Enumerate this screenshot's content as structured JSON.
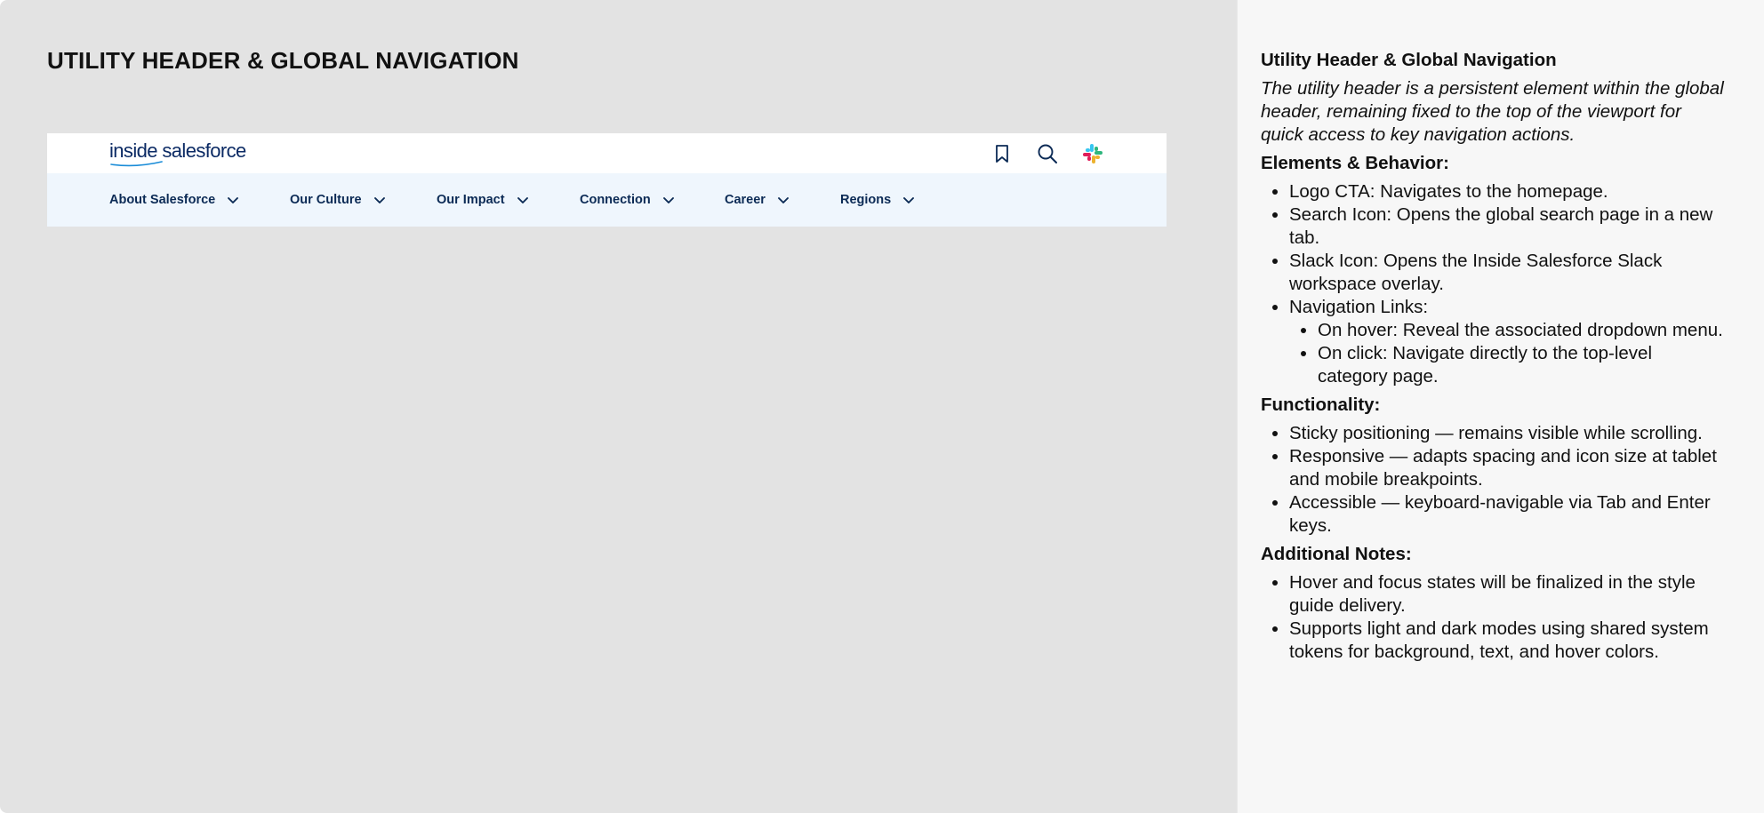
{
  "canvas": {
    "title": "UTILITY HEADER & GLOBAL NAVIGATION"
  },
  "header": {
    "logo_text": "inside salesforce",
    "utility_icons": [
      "bookmark-icon",
      "search-icon",
      "slack-icon"
    ],
    "nav": [
      {
        "label": "About Salesforce"
      },
      {
        "label": "Our Culture"
      },
      {
        "label": "Our Impact"
      },
      {
        "label": "Connection"
      },
      {
        "label": "Career"
      },
      {
        "label": "Regions"
      }
    ],
    "colors": {
      "nav_background": "#eff6fd",
      "text_navy": "#0b2a55",
      "logo_blue": "#0b2a64",
      "swoosh_blue": "#1a8cd8"
    }
  },
  "notes": {
    "title": "Utility Header & Global Navigation",
    "intro": "The utility header is a persistent element within the global header, remaining fixed to the top of the viewport for quick access to key navigation actions.",
    "elements_heading": "Elements & Behavior:",
    "elements": [
      "Logo CTA: Navigates to the homepage.",
      "Search Icon: Opens the global search page in a new tab.",
      "Slack Icon: Opens the Inside Salesforce Slack workspace overlay.",
      "Navigation Links:"
    ],
    "nav_link_behaviors": [
      "On hover: Reveal the associated dropdown menu.",
      "On click: Navigate directly to the top-level category page."
    ],
    "functionality_heading": "Functionality:",
    "functionality": [
      "Sticky positioning — remains visible while scrolling.",
      "Responsive — adapts spacing and icon size at tablet and mobile breakpoints.",
      "Accessible — keyboard-navigable via Tab and Enter keys."
    ],
    "additional_heading": "Additional Notes:",
    "additional": [
      "Hover and focus states will be finalized in the style guide delivery.",
      "Supports light and dark modes using shared system tokens for background, text, and hover colors."
    ]
  }
}
